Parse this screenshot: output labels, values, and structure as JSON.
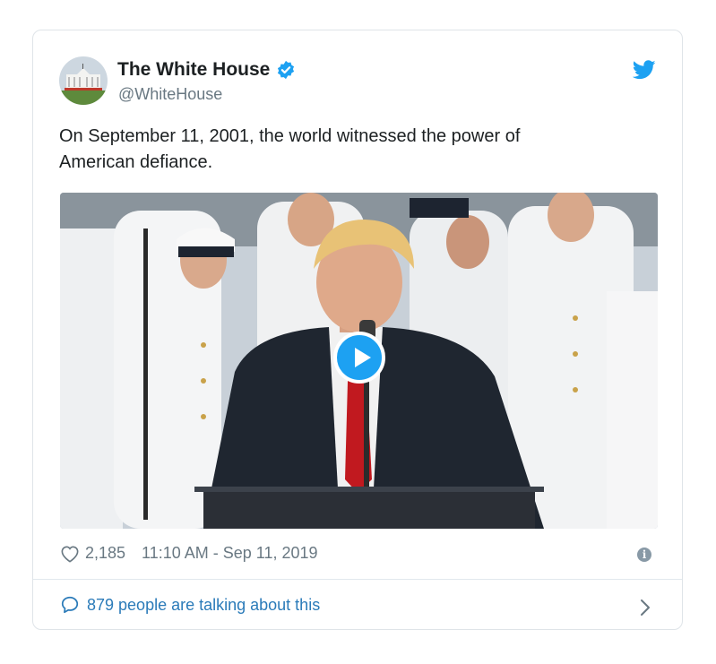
{
  "tweet": {
    "author_name": "The White House",
    "handle": "@WhiteHouse",
    "verified": true,
    "text": "On September 11, 2001, the world witnessed the power of\nAmerican defiance.",
    "likes": "2,185",
    "timestamp": "11:10 AM - Sep 11, 2019",
    "talking": "879 people are talking about this"
  },
  "icons": {
    "verified": "verified-badge-icon",
    "brand": "twitter-bird-icon",
    "play": "play-icon",
    "like": "heart-icon",
    "info": "info-icon",
    "reply": "speech-bubble-icon",
    "more": "chevron-right-icon"
  },
  "colors": {
    "accent": "#1da1f2",
    "link": "#2b7bb9",
    "muted": "#697882",
    "text": "#1c2022",
    "border": "#dfe4e8"
  }
}
